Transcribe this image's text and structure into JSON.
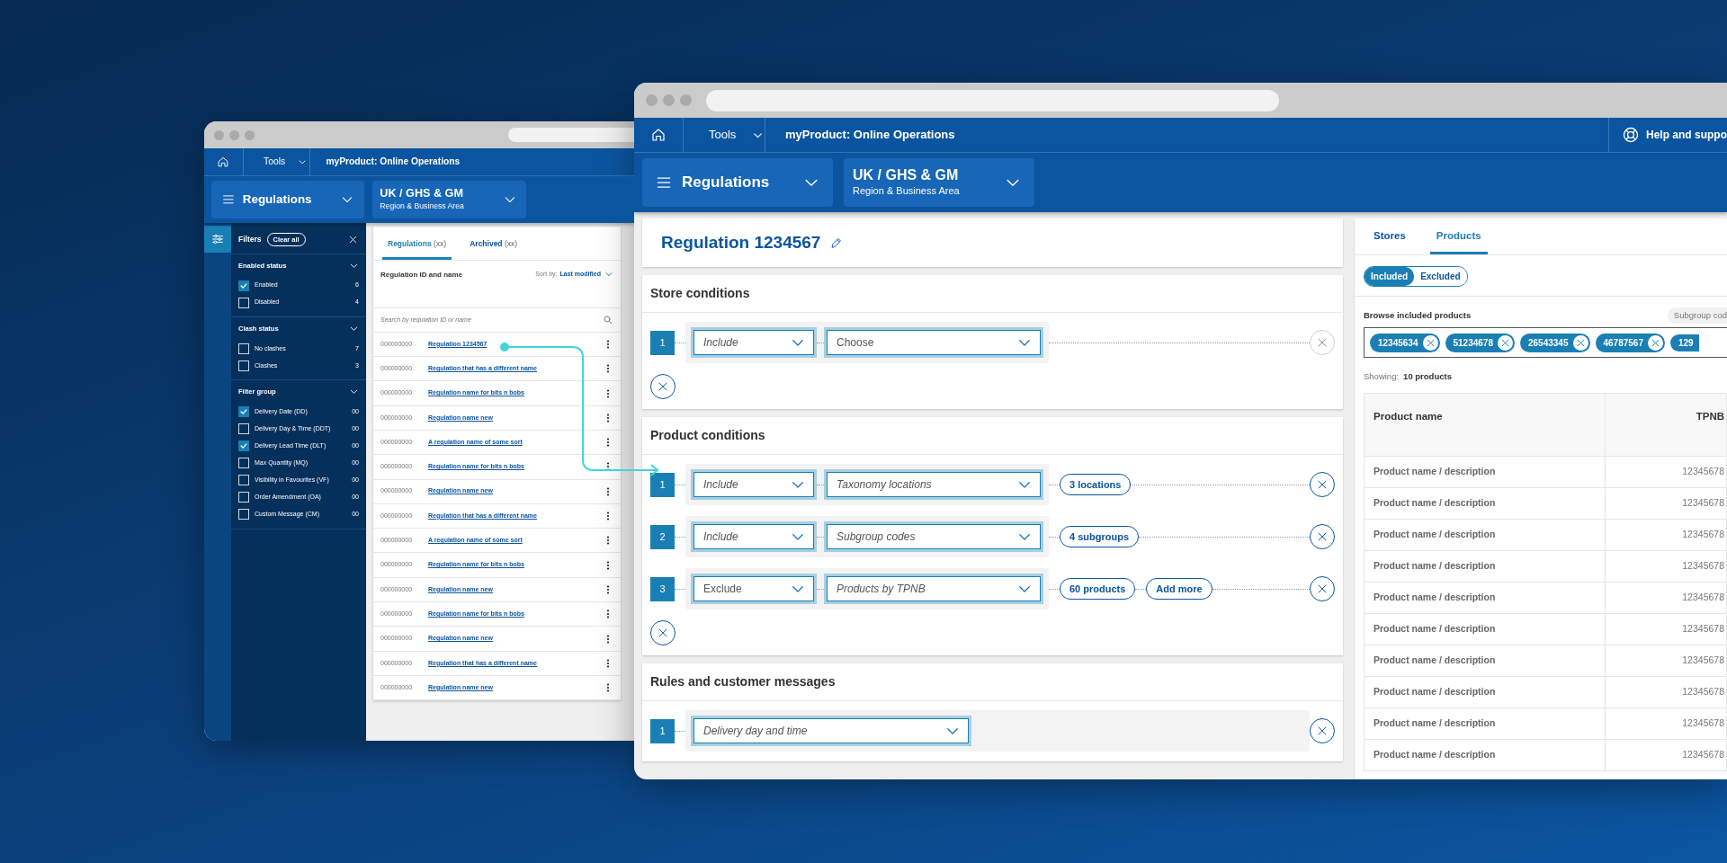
{
  "list_window": {
    "nav": {
      "tools": "Tools",
      "title": "myProduct: Online Operations"
    },
    "module_menu": {
      "label": "Regulations"
    },
    "region_menu": {
      "label": "UK / GHS & GM",
      "sublabel": "Region & Business Area"
    },
    "filters": {
      "title": "Filters",
      "clear": "Clear all",
      "groups": [
        {
          "title": "Enabled status",
          "options": [
            {
              "label": "Enabled",
              "count": "6",
              "checked": true
            },
            {
              "label": "Disabled",
              "count": "4",
              "checked": false
            }
          ]
        },
        {
          "title": "Clash status",
          "options": [
            {
              "label": "No clashes",
              "count": "7",
              "checked": false
            },
            {
              "label": "Clashes",
              "count": "3",
              "checked": false
            }
          ]
        },
        {
          "title": "Filter group",
          "options": [
            {
              "label": "Delivery Date (DD)",
              "count": "00",
              "checked": true
            },
            {
              "label": "Delivery Day & Time (DDT)",
              "count": "00",
              "checked": false
            },
            {
              "label": "Delivery Lead Time (DLT)",
              "count": "00",
              "checked": true
            },
            {
              "label": "Max Quantity (MQ)",
              "count": "00",
              "checked": false
            },
            {
              "label": "Visibility in Favourites (VF)",
              "count": "00",
              "checked": false
            },
            {
              "label": "Order Amendment (OA)",
              "count": "00",
              "checked": false
            },
            {
              "label": "Custom Message (CM)",
              "count": "00",
              "checked": false
            }
          ]
        }
      ]
    },
    "tabs": [
      {
        "label": "Regulations",
        "count": "(xx)",
        "selected": true
      },
      {
        "label": "Archived",
        "count": "(xx)",
        "selected": false
      }
    ],
    "list": {
      "column": "Regulation ID and name",
      "sort_label": "Sort by:",
      "sort_value": "Last modified",
      "search": {
        "placeholder": "Search by regulation ID or name"
      },
      "rows": [
        {
          "id": "000000000",
          "name": "Regulation 1234567"
        },
        {
          "id": "000000000",
          "name": "Regulation that has a different name"
        },
        {
          "id": "000000000",
          "name": "Regulation name for bits n bobs"
        },
        {
          "id": "000000000",
          "name": "Regulation name new"
        },
        {
          "id": "000000000",
          "name": "A regulation name of some sort"
        },
        {
          "id": "000000000",
          "name": "Regulation name for bits n bobs"
        },
        {
          "id": "000000000",
          "name": "Regulation name new"
        },
        {
          "id": "000000000",
          "name": "Regulation that has a different name"
        },
        {
          "id": "000000000",
          "name": "A regulation name of some sort"
        },
        {
          "id": "000000000",
          "name": "Regulation name for bits n bobs"
        },
        {
          "id": "000000000",
          "name": "Regulation name new"
        },
        {
          "id": "000000000",
          "name": "Regulation name for bits n bobs"
        },
        {
          "id": "000000000",
          "name": "Regulation name new"
        },
        {
          "id": "000000000",
          "name": "Regulation that has a different name"
        },
        {
          "id": "000000000",
          "name": "Regulation name new"
        }
      ]
    }
  },
  "detail_window": {
    "nav": {
      "tools": "Tools",
      "title": "myProduct: Online Operations",
      "help": "Help and suppo"
    },
    "module_menu": {
      "label": "Regulations"
    },
    "region_menu": {
      "label": "UK / GHS & GM",
      "sublabel": "Region & Business Area"
    },
    "title": "Regulation 1234567",
    "sections": [
      {
        "title": "Store conditions",
        "add_button": true,
        "conditions": [
          {
            "number": "1",
            "remove_disabled": true,
            "selects": [
              {
                "value": "Include",
                "italic": true
              },
              {
                "value": "Choose",
                "italic": false
              }
            ]
          }
        ]
      },
      {
        "title": "Product conditions",
        "add_button": true,
        "conditions": [
          {
            "number": "1",
            "remove_disabled": false,
            "selects": [
              {
                "value": "Include",
                "italic": true
              },
              {
                "value": "Taxonomy locations",
                "italic": true
              }
            ],
            "tags": [
              "3 locations"
            ]
          },
          {
            "number": "2",
            "remove_disabled": false,
            "selects": [
              {
                "value": "Include",
                "italic": true
              },
              {
                "value": "Subgroup codes",
                "italic": true
              }
            ],
            "tags": [
              "4 subgroups"
            ]
          },
          {
            "number": "3",
            "remove_disabled": false,
            "selects": [
              {
                "value": "Exclude",
                "italic": false
              },
              {
                "value": "Products by TPNB",
                "italic": true
              }
            ],
            "tags": [
              "60 products",
              "Add more"
            ]
          }
        ]
      },
      {
        "title": "Rules and customer messages",
        "conditions": [
          {
            "number": "1",
            "remove_disabled": false,
            "wide": true,
            "selects": [
              {
                "value": "Delivery day and time",
                "italic": true
              }
            ]
          }
        ]
      }
    ],
    "side_panel": {
      "tabs": [
        {
          "label": "Stores",
          "selected": false
        },
        {
          "label": "Products",
          "selected": true
        }
      ],
      "toggle": [
        {
          "label": "Included",
          "selected": true
        },
        {
          "label": "Excluded",
          "selected": false
        }
      ],
      "browse_label": "Browse included products",
      "filter_chip": "Subgroup cod",
      "chips": [
        {
          "label": "12345634",
          "removable": true
        },
        {
          "label": "51234678",
          "removable": true
        },
        {
          "label": "26543345",
          "removable": true
        },
        {
          "label": "46787567",
          "removable": true
        },
        {
          "label": "129",
          "removable": false
        }
      ],
      "showing_label": "Showing:",
      "showing_value": "10 products",
      "table": {
        "columns": [
          "Product name",
          "TPNB"
        ],
        "rows": [
          [
            "Product name / description",
            "12345678"
          ],
          [
            "Product name / description",
            "12345678"
          ],
          [
            "Product name / description",
            "12345678"
          ],
          [
            "Product name / description",
            "12345678"
          ],
          [
            "Product name / description",
            "12345678"
          ],
          [
            "Product name / description",
            "12345678"
          ],
          [
            "Product name / description",
            "12345678"
          ],
          [
            "Product name / description",
            "12345678"
          ],
          [
            "Product name / description",
            "12345678"
          ],
          [
            "Product name / description",
            "12345678"
          ]
        ]
      }
    }
  }
}
